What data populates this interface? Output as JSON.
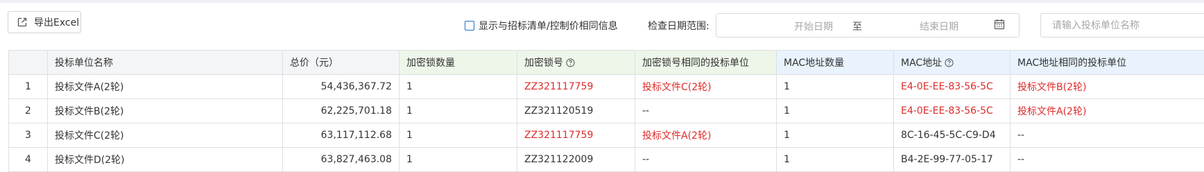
{
  "toolbar": {
    "export_label": "导出Excel",
    "show_same_label": "显示与招标清单/控制价相同信息",
    "range_label": "检查日期范围:",
    "start_placeholder": "开始日期",
    "range_separator": "至",
    "end_placeholder": "结束日期",
    "search_placeholder": "请输入投标单位名称"
  },
  "table": {
    "headers": {
      "name": "投标单位名称",
      "price": "总价（元）",
      "lock_count": "加密锁数量",
      "lock_no": "加密锁号",
      "lock_same": "加密锁号相同的投标单位",
      "mac_count": "MAC地址数量",
      "mac": "MAC地址",
      "mac_same": "MAC地址相同的投标单位"
    },
    "rows": [
      {
        "idx": "1",
        "name": "投标文件A(2轮)",
        "price": "54,436,367.72",
        "lock_count": "1",
        "lock_no": "ZZ321117759",
        "lock_same": "投标文件C(2轮)",
        "mac_count": "1",
        "mac": "E4-0E-EE-83-56-5C",
        "mac_same": "投标文件B(2轮)"
      },
      {
        "idx": "2",
        "name": "投标文件B(2轮)",
        "price": "62,225,701.18",
        "lock_count": "1",
        "lock_no": "ZZ321120519",
        "lock_same": "--",
        "mac_count": "1",
        "mac": "E4-0E-EE-83-56-5C",
        "mac_same": "投标文件A(2轮)"
      },
      {
        "idx": "3",
        "name": "投标文件C(2轮)",
        "price": "63,117,112.68",
        "lock_count": "1",
        "lock_no": "ZZ321117759",
        "lock_same": "投标文件A(2轮)",
        "mac_count": "1",
        "mac": "8C-16-45-5C-C9-D4",
        "mac_same": "--"
      },
      {
        "idx": "4",
        "name": "投标文件D(2轮)",
        "price": "63,827,463.08",
        "lock_count": "1",
        "lock_no": "ZZ321122009",
        "lock_same": "--",
        "mac_count": "1",
        "mac": "B4-2E-99-77-05-17",
        "mac_same": "--"
      }
    ]
  },
  "colors": {
    "highlight": "#e02a2a",
    "checkbox_border": "#1f6fd6",
    "lock_header_bg": "#eef6e9",
    "mac_header_bg": "#e8f3fd"
  },
  "icons": {
    "export": "external-link-icon",
    "calendar": "calendar-icon",
    "help": "question-circle-icon"
  }
}
